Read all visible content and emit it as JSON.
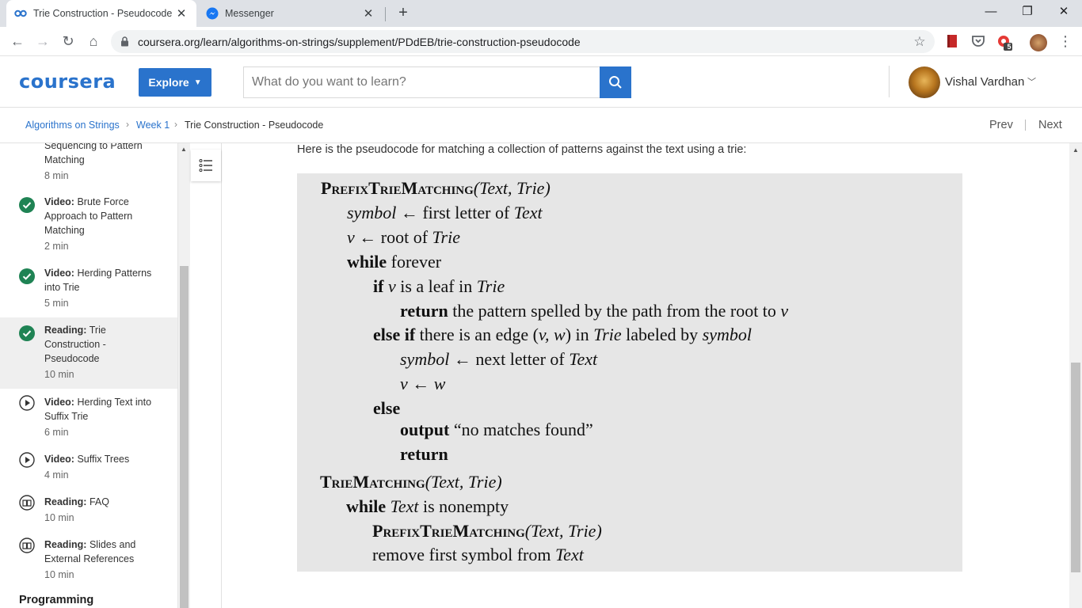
{
  "browser": {
    "tabs": [
      {
        "title": "Trie Construction - Pseudocode | Coursera",
        "active": true
      },
      {
        "title": "Messenger",
        "active": false
      }
    ],
    "url": "coursera.org/learn/algorithms-on-strings/supplement/PDdEB/trie-construction-pseudocode",
    "extension_badge": "5"
  },
  "header": {
    "logo": "coursera",
    "explore_label": "Explore",
    "search_placeholder": "What do you want to learn?",
    "user_name": "Vishal Vardhan"
  },
  "breadcrumb": {
    "course": "Algorithms on Strings",
    "week": "Week 1",
    "current": "Trie Construction - Pseudocode",
    "prev": "Prev",
    "next": "Next"
  },
  "sidebar": {
    "items": [
      {
        "type": "",
        "title": "Sequencing to Pattern Matching",
        "duration": "8 min",
        "status": "partial"
      },
      {
        "type": "Video:",
        "title": "Brute Force Approach to Pattern Matching",
        "duration": "2 min",
        "status": "completed"
      },
      {
        "type": "Video:",
        "title": "Herding Patterns into Trie",
        "duration": "5 min",
        "status": "completed"
      },
      {
        "type": "Reading:",
        "title": "Trie Construction - Pseudocode",
        "duration": "10 min",
        "status": "completed",
        "selected": true
      },
      {
        "type": "Video:",
        "title": "Herding Text into Suffix Trie",
        "duration": "6 min",
        "status": "video"
      },
      {
        "type": "Video:",
        "title": "Suffix Trees",
        "duration": "4 min",
        "status": "video"
      },
      {
        "type": "Reading:",
        "title": "FAQ",
        "duration": "10 min",
        "status": "reading"
      },
      {
        "type": "Reading:",
        "title": "Slides and External References",
        "duration": "10 min",
        "status": "reading"
      }
    ],
    "next_section": "Programming"
  },
  "content": {
    "intro": "Here is the pseudocode for matching a collection of patterns against the text using a trie:",
    "code": {
      "l1_fn": "PrefixTrieMatching",
      "l1_args": "(Text, Trie)",
      "l2_a": "symbol",
      "l2_b": " ← first letter of ",
      "l2_c": "Text",
      "l3_a": "v",
      "l3_b": " ← root of ",
      "l3_c": "Trie",
      "l4_kw": "while",
      "l4_b": " forever",
      "l5_kw": "if",
      "l5_a": " v",
      "l5_b": " is a leaf in ",
      "l5_c": "Trie",
      "l6_kw": "return",
      "l6_b": " the pattern spelled by the path from the root to ",
      "l6_c": "v",
      "l7_kw": "else if",
      "l7_b": " there is an edge (",
      "l7_c": "v, w",
      "l7_d": ") in ",
      "l7_e": "Trie",
      "l7_f": " labeled by ",
      "l7_g": "symbol",
      "l8_a": "symbol",
      "l8_b": " ← next letter of ",
      "l8_c": "Text",
      "l9_a": "v",
      "l9_b": " ← ",
      "l9_c": "w",
      "l10_kw": "else",
      "l11_kw": "output",
      "l11_b": " “no matches found”",
      "l12_kw": "return",
      "l13_fn": "TrieMatching",
      "l13_args": "(Text, Trie)",
      "l14_kw": "while",
      "l14_a": " Text",
      "l14_b": " is nonempty",
      "l15_fn": "PrefixTrieMatching",
      "l15_args": "(Text, Trie)",
      "l16_a": "remove first symbol from ",
      "l16_b": "Text"
    }
  },
  "colors": {
    "brand": "#2a73cc",
    "completed": "#1f8354",
    "code_bg": "#e6e6e6",
    "selected_item": "#efefef"
  }
}
